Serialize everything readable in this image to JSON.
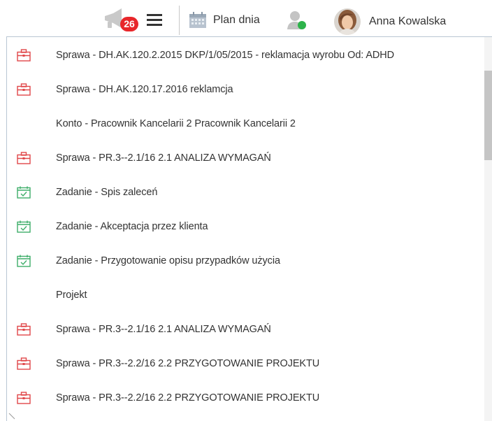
{
  "header": {
    "notification_count": "26",
    "plan_label": "Plan dnia",
    "user_name": "Anna Kowalska",
    "icons": {
      "announce": "megaphone-icon",
      "menu": "hamburger-menu-icon",
      "plan": "calendar-icon",
      "presence": "user-presence-icon",
      "avatar": "user-avatar"
    }
  },
  "colors": {
    "badge": "#e8262a",
    "case_icon": "#e0484a",
    "task_icon": "#3fae6a",
    "online": "#2db34a"
  },
  "items": [
    {
      "icon": "briefcase-icon",
      "label": "Sprawa - DH.AK.120.2.2015 DKP/1/05/2015 - reklamacja wyrobu Od: ADHD"
    },
    {
      "icon": "briefcase-icon",
      "label": "Sprawa - DH.AK.120.17.2016 reklamcja"
    },
    {
      "icon": "",
      "label": "Konto - Pracownik Kancelarii 2 Pracownik Kancelarii 2"
    },
    {
      "icon": "briefcase-icon",
      "label": "Sprawa - PR.3--2.1/16 2.1 ANALIZA WYMAGAŃ"
    },
    {
      "icon": "calendar-check-icon",
      "label": "Zadanie - Spis zaleceń"
    },
    {
      "icon": "calendar-check-icon",
      "label": "Zadanie - Akceptacja przez klienta"
    },
    {
      "icon": "calendar-check-icon",
      "label": "Zadanie - Przygotowanie opisu przypadków użycia"
    },
    {
      "icon": "",
      "label": "Projekt"
    },
    {
      "icon": "briefcase-icon",
      "label": "Sprawa - PR.3--2.1/16 2.1 ANALIZA WYMAGAŃ"
    },
    {
      "icon": "briefcase-icon",
      "label": "Sprawa - PR.3--2.2/16 2.2 PRZYGOTOWANIE PROJEKTU"
    },
    {
      "icon": "briefcase-icon",
      "label": "Sprawa - PR.3--2.2/16 2.2 PRZYGOTOWANIE PROJEKTU"
    }
  ]
}
